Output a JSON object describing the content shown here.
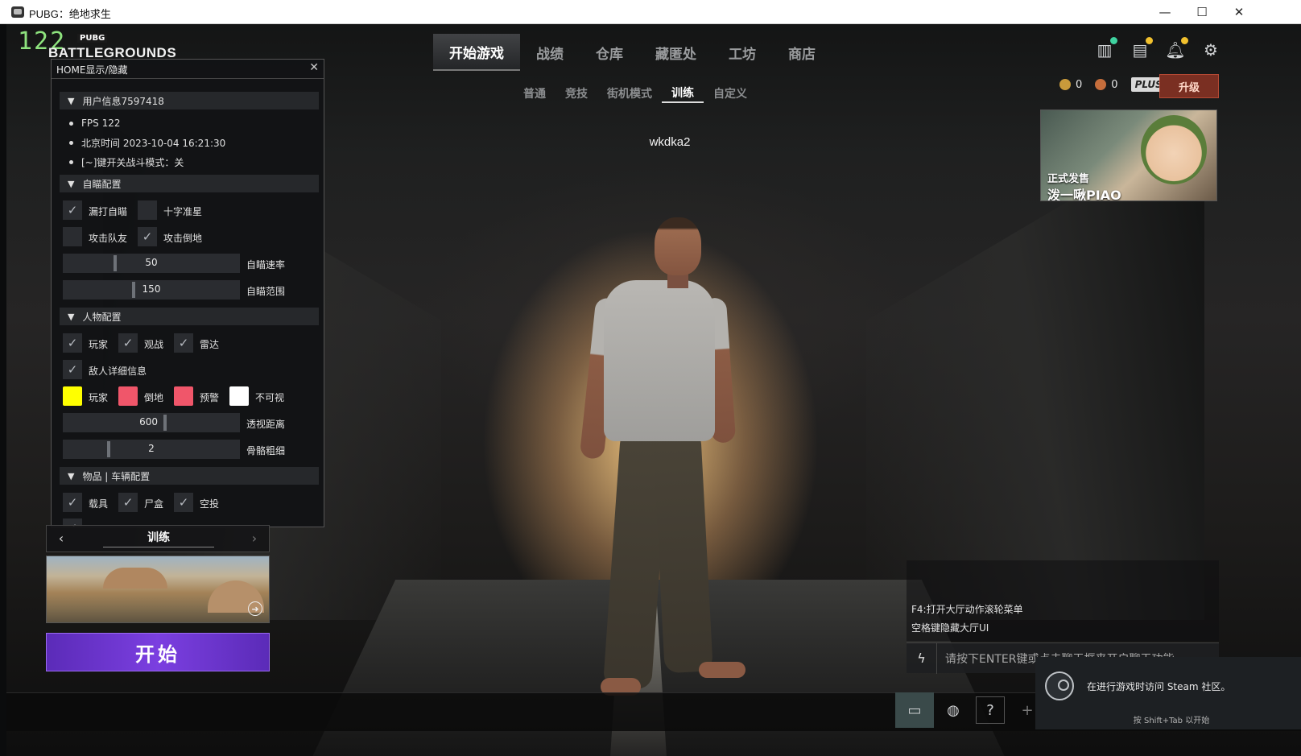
{
  "window": {
    "title": "PUBG：绝地求生",
    "minimize": "—",
    "maximize": "☐",
    "close": "✕"
  },
  "overlay_fps": "122",
  "logo": {
    "small": "PUBG",
    "big": "BATTLEGROUNDS"
  },
  "main_nav": [
    {
      "label": "开始游戏",
      "active": true
    },
    {
      "label": "战绩"
    },
    {
      "label": "仓库"
    },
    {
      "label": "藏匿处"
    },
    {
      "label": "工坊"
    },
    {
      "label": "商店"
    }
  ],
  "sub_nav": [
    {
      "label": "普通"
    },
    {
      "label": "竞技"
    },
    {
      "label": "街机模式"
    },
    {
      "label": "训练",
      "active": true
    },
    {
      "label": "自定义"
    }
  ],
  "top_icons": [
    "store-icon",
    "missions-icon",
    "notification-bell-icon",
    "settings-gear-icon"
  ],
  "currency": {
    "gcoin": "0",
    "bp": "0",
    "plus": "PLUS+",
    "upgrade": "升级"
  },
  "promo": {
    "line1": "正式发售",
    "line2": "泼一啾PIAO"
  },
  "player_name": "wkdka2",
  "menu": {
    "title": "HOME显示/隐藏",
    "close": "✕",
    "user_section": "用户信息7597418",
    "fps": "FPS 122",
    "beijing_time": "北京时间 2023-10-04 16:21:30",
    "combat_mode": "[~]键开关战斗模式：关",
    "aim_section": "自瞄配置",
    "aim_checks": [
      {
        "label": "漏打自瞄",
        "checked": true
      },
      {
        "label": "十字准星",
        "checked": false
      },
      {
        "label": "攻击队友",
        "checked": false
      },
      {
        "label": "攻击倒地",
        "checked": true
      }
    ],
    "aim_speed": {
      "value": "50",
      "label": "自瞄速率",
      "fraction": 0.3
    },
    "aim_range": {
      "value": "150",
      "label": "自瞄范围",
      "fraction": 0.4
    },
    "char_section": "人物配置",
    "char_checks": [
      {
        "label": "玩家",
        "checked": true
      },
      {
        "label": "观战",
        "checked": true
      },
      {
        "label": "雷达",
        "checked": true
      },
      {
        "label": "敌人详细信息",
        "checked": true
      }
    ],
    "colors": [
      {
        "label": "玩家",
        "color": "#ffff00"
      },
      {
        "label": "倒地",
        "color": "#f0566a"
      },
      {
        "label": "预警",
        "color": "#f0566a"
      },
      {
        "label": "不可视",
        "color": "#ffffff"
      }
    ],
    "esp_distance": {
      "value": "600",
      "label": "透视距离",
      "fraction": 0.57
    },
    "bone_thickness": {
      "value": "2",
      "label": "骨骼粗细",
      "fraction": 0.25
    },
    "item_section": "物品 | 车辆配置",
    "item_checks": [
      {
        "label": "载具",
        "checked": true
      },
      {
        "label": "尸盒",
        "checked": true
      },
      {
        "label": "空投",
        "checked": true
      }
    ]
  },
  "mode_selector": {
    "label": "训练",
    "prev": "‹",
    "next": "›"
  },
  "start_button": "开始",
  "hints": [
    "F4:打开大厅动作滚轮菜单",
    "空格键隐藏大厅UI"
  ],
  "chat_placeholder": "请按下ENTER键或点击聊天框来开启聊天功能",
  "steam": {
    "message": "在进行游戏时访问 Steam 社区。",
    "sub": "按 Shift+Tab 以开始"
  }
}
